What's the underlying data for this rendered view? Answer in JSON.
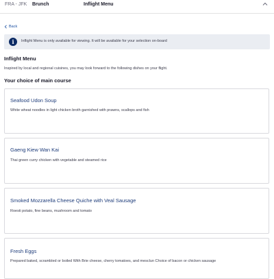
{
  "header": {
    "route": "FRA - JFK",
    "meal": "Brunch",
    "title": "Inflight Menu",
    "collapse_icon": "chevron-up-icon"
  },
  "back": {
    "label": "Back",
    "icon": "chevron-left-icon"
  },
  "notice": {
    "icon": "info-icon",
    "text": "Inflight Menu is only available for viewing. It will be available for your selection on-board"
  },
  "section": {
    "title": "Inflight Menu",
    "intro": "Inspired by local and regional cuisines, you may look forward to the following dishes on your flight.",
    "subtitle": "Your choice of main course"
  },
  "courses": [
    {
      "name": "Seafood Udon Soup",
      "description": "White wheat noodles in light chicken broth garnished with prawns, scallops and fish"
    },
    {
      "name": "Gaeng Kiew Wan Kai",
      "description": "Thai green curry chicken with vegetable and steamed rice"
    },
    {
      "name": "Smoked Mozzarella Cheese Quiche with Veal Sausage",
      "description": "Roesti potato, fine beans, mushroom and tomato"
    },
    {
      "name": "Fresh Eggs",
      "description": "Prepared baked, scrambled or boiled With Brie cheese, cherry tomatoes, and mesclun Choice of bacon or chicken sausage"
    }
  ],
  "colors": {
    "accent": "#1e3c7a",
    "notice_bg": "#eaedf2",
    "info_icon_bg": "#0b2a64"
  }
}
